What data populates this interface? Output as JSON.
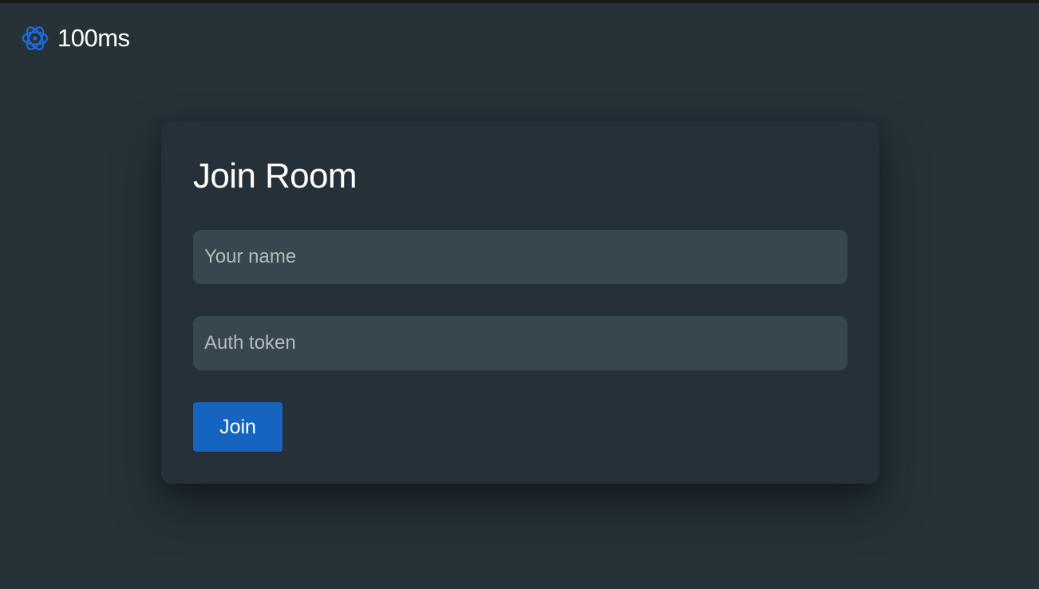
{
  "brand": {
    "name": "100ms",
    "logo_icon": "100ms-logo-icon",
    "logo_color": "#1e6ae0"
  },
  "form": {
    "title": "Join Room",
    "name_field": {
      "value": "",
      "placeholder": "Your name"
    },
    "token_field": {
      "value": "",
      "placeholder": "Auth token"
    },
    "join_label": "Join"
  },
  "colors": {
    "page_background": "#263238",
    "card_background": "#263038",
    "input_background": "#37474f",
    "accent": "#1565c0",
    "placeholder_text": "#b6bbbe",
    "text": "#ffffff"
  }
}
